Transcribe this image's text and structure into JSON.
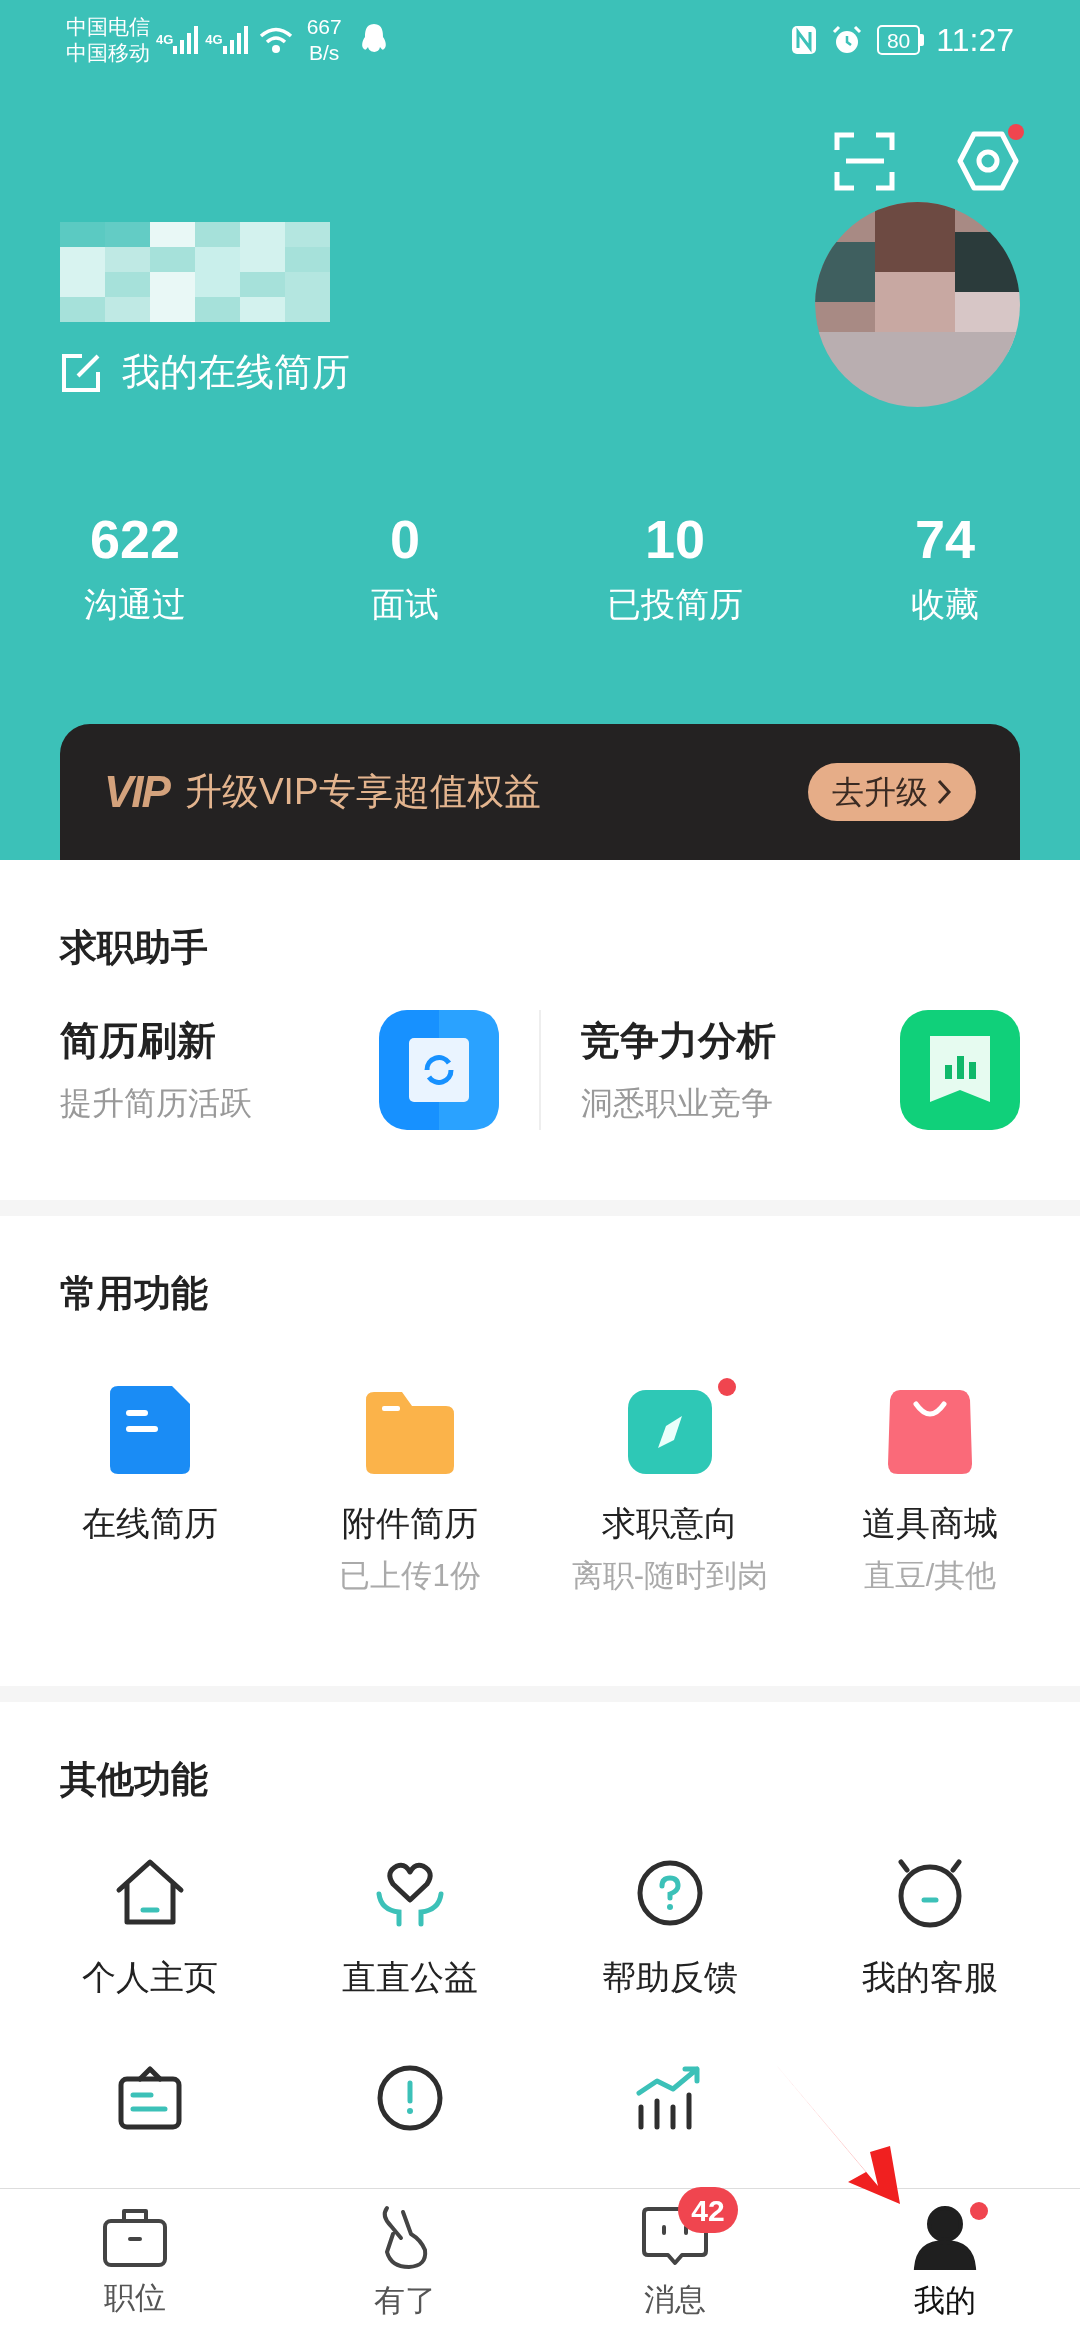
{
  "status_bar": {
    "carriers": [
      "中国电信",
      "中国移动"
    ],
    "signals": [
      "4G",
      "4G"
    ],
    "speed": "667",
    "speed_unit": "B/s",
    "battery": "80",
    "time": "11:27"
  },
  "header": {
    "settings_dot": true,
    "resume_link": "我的在线简历",
    "stats": [
      {
        "value": "622",
        "label": "沟通过"
      },
      {
        "value": "0",
        "label": "面试"
      },
      {
        "value": "10",
        "label": "已投简历"
      },
      {
        "value": "74",
        "label": "收藏"
      }
    ]
  },
  "vip": {
    "logo": "VIP",
    "text": "升级VIP专享超值权益",
    "button": "去升级"
  },
  "assistant": {
    "title": "求职助手",
    "items": [
      {
        "kind": "refresh",
        "title": "简历刷新",
        "subtitle": "提升简历活跃"
      },
      {
        "kind": "analysis",
        "title": "竞争力分析",
        "subtitle": "洞悉职业竞争"
      }
    ]
  },
  "common": {
    "title": "常用功能",
    "items": [
      {
        "kind": "resume",
        "label": "在线简历",
        "dot": false
      },
      {
        "kind": "folder",
        "label": "附件简历",
        "sub": "已上传1份",
        "dot": false
      },
      {
        "kind": "compass",
        "label": "求职意向",
        "sub": "离职-随时到岗",
        "dot": true
      },
      {
        "kind": "shop",
        "label": "道具商城",
        "sub": "直豆/其他",
        "dot": false
      }
    ]
  },
  "other": {
    "title": "其他功能",
    "items": [
      {
        "kind": "home",
        "label": "个人主页"
      },
      {
        "kind": "charity",
        "label": "直直公益"
      },
      {
        "kind": "help",
        "label": "帮助反馈"
      },
      {
        "kind": "service",
        "label": "我的客服"
      },
      {
        "kind": "notice"
      },
      {
        "kind": "about"
      },
      {
        "kind": "salary"
      }
    ]
  },
  "nav": [
    {
      "kind": "jobs",
      "label": "职位",
      "selected": false,
      "dot": false
    },
    {
      "kind": "youle",
      "label": "有了",
      "selected": false,
      "dot": false
    },
    {
      "kind": "messages",
      "label": "消息",
      "selected": false,
      "dot": false,
      "badge": "42"
    },
    {
      "kind": "me",
      "label": "我的",
      "selected": true,
      "dot": true
    }
  ]
}
